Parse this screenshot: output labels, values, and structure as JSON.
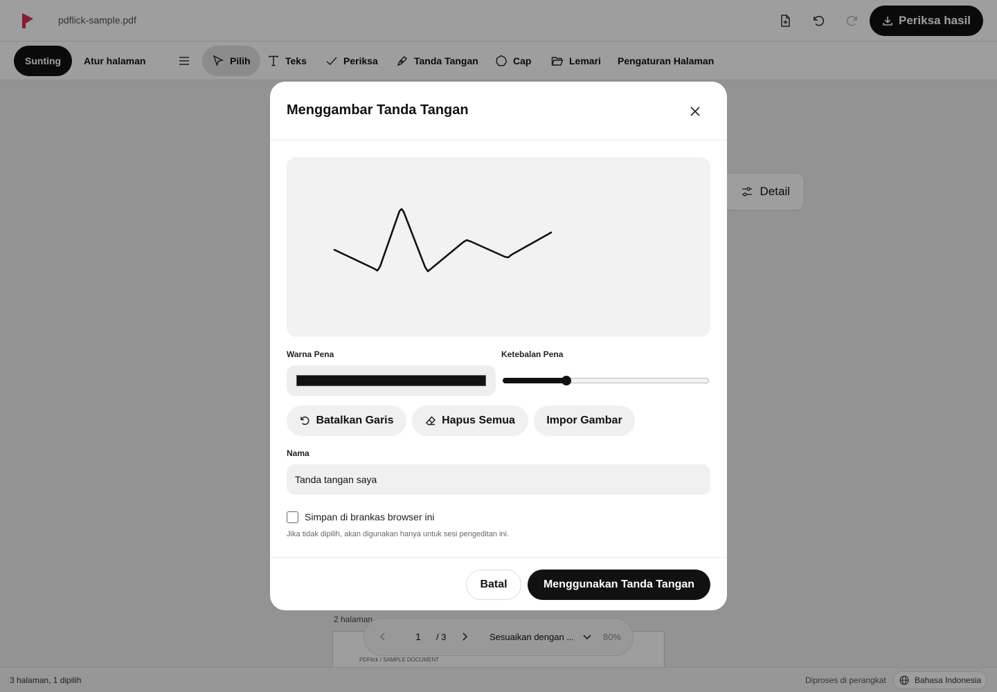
{
  "app": {
    "filename": "pdflick-sample.pdf",
    "export_label": "Periksa hasil",
    "brand_color": "#e03a5a"
  },
  "mode_tabs": [
    {
      "label": "Sunting",
      "active": true
    },
    {
      "label": "Atur halaman",
      "active": false
    }
  ],
  "tools": [
    {
      "label": "Pilih",
      "icon": "cursor-icon",
      "active": true
    },
    {
      "label": "Teks",
      "icon": "text-icon",
      "active": false
    },
    {
      "label": "Periksa",
      "icon": "check-icon",
      "active": false
    },
    {
      "label": "Tanda Tangan",
      "icon": "pen-icon",
      "active": false
    },
    {
      "label": "Cap",
      "icon": "stamp-icon",
      "active": false
    },
    {
      "label": "Lemari",
      "icon": "folder-icon",
      "active": false
    },
    {
      "label": "Pengaturan Halaman",
      "icon": "",
      "active": false
    }
  ],
  "detail_label": "Detail",
  "page_section_label": "2 halaman",
  "page_thumb_text": "PDFlick / SAMPLE DOCUMENT",
  "pager": {
    "current_page": "1",
    "total": "/ 3",
    "fit_label": "Sesuaikan dengan ...",
    "zoom": "80%"
  },
  "status": {
    "selection": "3 halaman, 1 dipilih",
    "processing": "Diproses di perangkat",
    "language": "Bahasa Indonesia"
  },
  "modal": {
    "title": "Menggambar Tanda Tangan",
    "pen_color_label": "Warna Pena",
    "pen_color": "#111111",
    "pen_thickness_label": "Ketebalan Pena",
    "pen_thickness_fraction": 0.31,
    "undo_stroke_label": "Batalkan Garis",
    "clear_all_label": "Hapus Semua",
    "import_image_label": "Impor Gambar",
    "name_label": "Nama",
    "name_value": "Tanda tangan saya",
    "save_checkbox_label": "Simpan di brankas browser ini",
    "save_checked": false,
    "hint": "Jika tidak dipilih, akan digunakan hanya untuk sesi pengeditan ini.",
    "cancel_label": "Batal",
    "confirm_label": "Menggunakan Tanda Tangan"
  }
}
